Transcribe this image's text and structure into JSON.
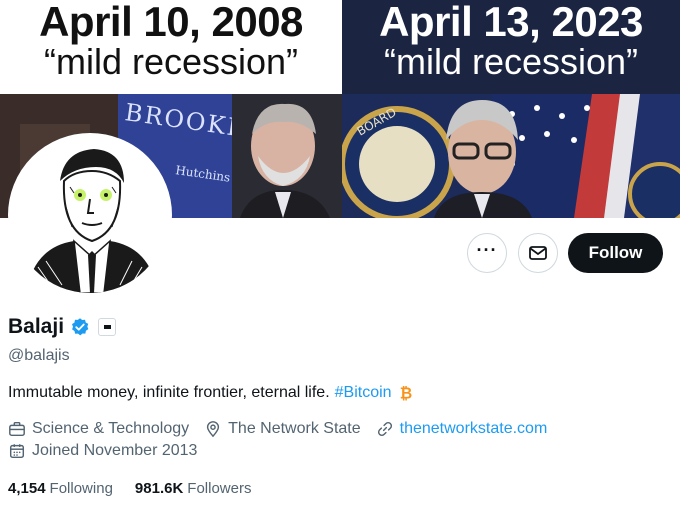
{
  "banner": {
    "left": {
      "date": "April 10, 2008",
      "quote": "“mild recession”",
      "sign_text": "BROOKINGS"
    },
    "right": {
      "date": "April 13, 2023",
      "quote": "“mild recession”"
    }
  },
  "actions": {
    "more_icon": "more-icon",
    "message_icon": "mail-icon",
    "follow_label": "Follow"
  },
  "profile": {
    "name": "Balaji",
    "verified_color": "#1d9bf0",
    "handle": "@balajis",
    "bio_text": "Immutable money, infinite frontier, eternal life.",
    "bio_hashtag": "#Bitcoin",
    "bitcoin_color": "#f7931a",
    "category": "Science & Technology",
    "location": "The Network State",
    "website": "thenetworkstate.com",
    "joined": "Joined November 2013"
  },
  "stats": {
    "following_count": "4,154",
    "following_label": "Following",
    "followers_count": "981.6K",
    "followers_label": "Followers"
  }
}
